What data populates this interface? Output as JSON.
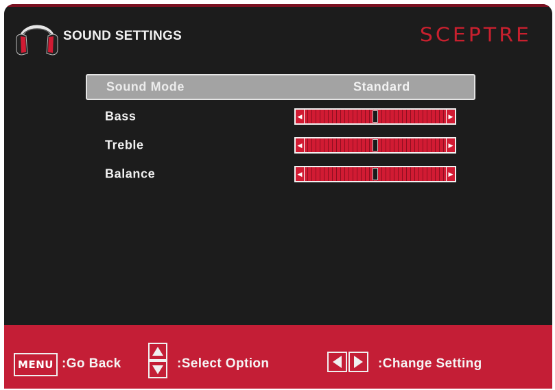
{
  "header": {
    "title": "SOUND SETTINGS",
    "brand": "SCEPTRE",
    "icon": "headphones-icon"
  },
  "menu": {
    "rows": [
      {
        "label": "Sound Mode",
        "value": "Standard",
        "selected": true
      },
      {
        "label": "Bass",
        "slider_level": 0.5
      },
      {
        "label": "Treble",
        "slider_level": 0.5
      },
      {
        "label": "Balance",
        "slider_level": 0.5
      }
    ]
  },
  "footer": {
    "menu_key": "MENU",
    "go_back": ":Go Back",
    "select_option": ":Select Option",
    "change_setting": ":Change Setting"
  },
  "colors": {
    "background": "#1c1c1c",
    "accent_red": "#c41e36",
    "brand_red": "#c8202e",
    "selection_gray": "#a3a3a3"
  }
}
